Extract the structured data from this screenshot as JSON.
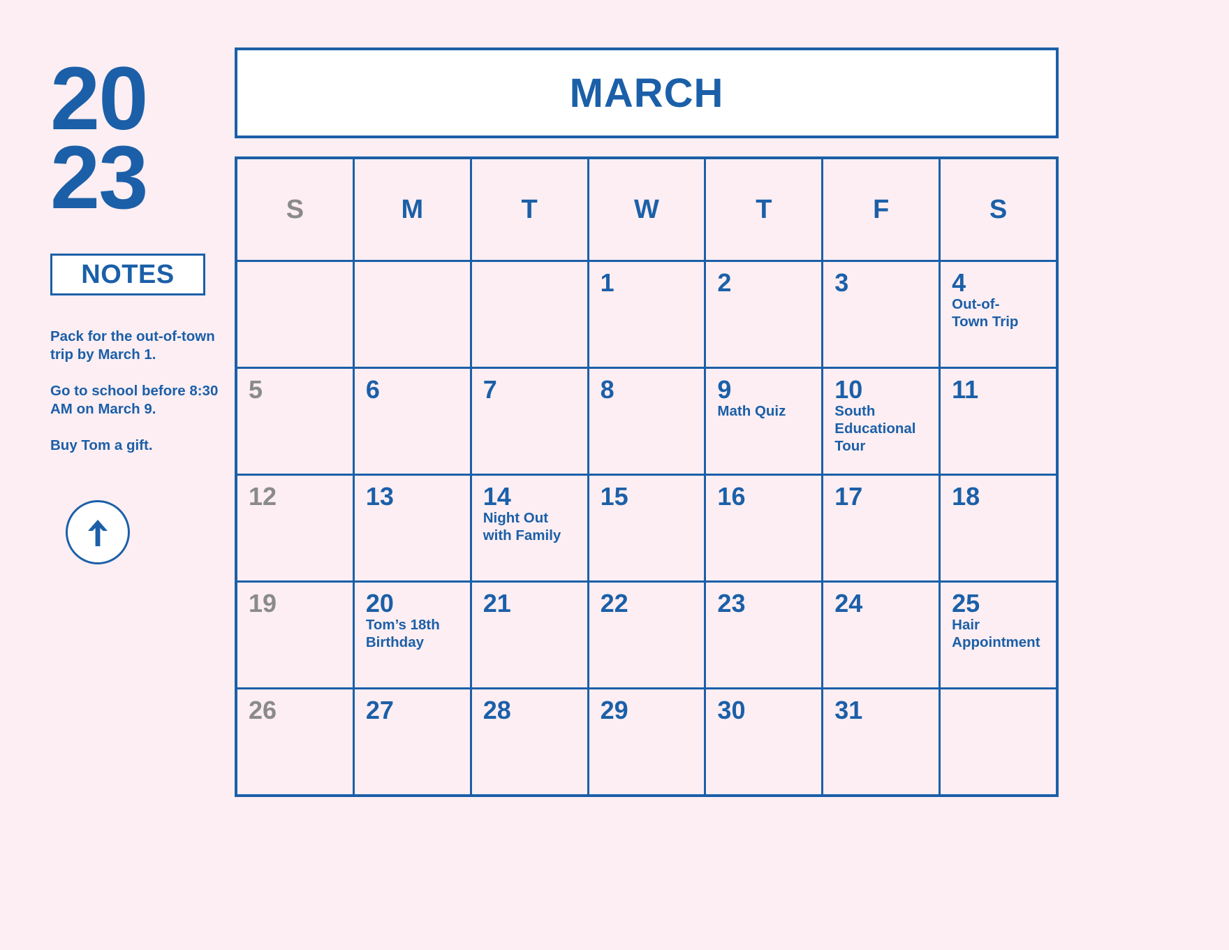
{
  "colors": {
    "page_background": "#fceef2",
    "accent": "#1b5fa8",
    "muted": "#8a8a8a",
    "panel_background": "#ffffff"
  },
  "sidebar": {
    "year_line_1": "20",
    "year_line_2": "23",
    "notes_label": "NOTES",
    "notes": [
      "Pack for the out-of-town trip by March 1.",
      "Go to school before 8:30 AM on March 9.",
      "Buy Tom a gift."
    ],
    "scroll_arrow_icon": "arrow-up-icon"
  },
  "calendar": {
    "month_title": "MARCH",
    "weekday_headers": [
      {
        "label": "S",
        "muted": true
      },
      {
        "label": "M",
        "muted": false
      },
      {
        "label": "T",
        "muted": false
      },
      {
        "label": "W",
        "muted": false
      },
      {
        "label": "T",
        "muted": false
      },
      {
        "label": "F",
        "muted": false
      },
      {
        "label": "S",
        "muted": false
      }
    ],
    "weeks": [
      [
        {
          "day": "",
          "event": "",
          "muted": false,
          "empty": true
        },
        {
          "day": "",
          "event": "",
          "muted": false,
          "empty": true
        },
        {
          "day": "",
          "event": "",
          "muted": false,
          "empty": true
        },
        {
          "day": "1",
          "event": "",
          "muted": false,
          "empty": false
        },
        {
          "day": "2",
          "event": "",
          "muted": false,
          "empty": false
        },
        {
          "day": "3",
          "event": "",
          "muted": false,
          "empty": false
        },
        {
          "day": "4",
          "event": "Out-of-\nTown Trip",
          "muted": false,
          "empty": false
        }
      ],
      [
        {
          "day": "5",
          "event": "",
          "muted": true,
          "empty": false
        },
        {
          "day": "6",
          "event": "",
          "muted": false,
          "empty": false
        },
        {
          "day": "7",
          "event": "",
          "muted": false,
          "empty": false
        },
        {
          "day": "8",
          "event": "",
          "muted": false,
          "empty": false
        },
        {
          "day": "9",
          "event": "Math Quiz",
          "muted": false,
          "empty": false
        },
        {
          "day": "10",
          "event": "South\nEducational\nTour",
          "muted": false,
          "empty": false
        },
        {
          "day": "11",
          "event": "",
          "muted": false,
          "empty": false
        }
      ],
      [
        {
          "day": "12",
          "event": "",
          "muted": true,
          "empty": false
        },
        {
          "day": "13",
          "event": "",
          "muted": false,
          "empty": false
        },
        {
          "day": "14",
          "event": "Night Out\nwith Family",
          "muted": false,
          "empty": false
        },
        {
          "day": "15",
          "event": "",
          "muted": false,
          "empty": false
        },
        {
          "day": "16",
          "event": "",
          "muted": false,
          "empty": false
        },
        {
          "day": "17",
          "event": "",
          "muted": false,
          "empty": false
        },
        {
          "day": "18",
          "event": "",
          "muted": false,
          "empty": false
        }
      ],
      [
        {
          "day": "19",
          "event": "",
          "muted": true,
          "empty": false
        },
        {
          "day": "20",
          "event": "Tom’s 18th\nBirthday",
          "muted": false,
          "empty": false
        },
        {
          "day": "21",
          "event": "",
          "muted": false,
          "empty": false
        },
        {
          "day": "22",
          "event": "",
          "muted": false,
          "empty": false
        },
        {
          "day": "23",
          "event": "",
          "muted": false,
          "empty": false
        },
        {
          "day": "24",
          "event": "",
          "muted": false,
          "empty": false
        },
        {
          "day": "25",
          "event": "Hair\nAppointment",
          "muted": false,
          "empty": false
        }
      ],
      [
        {
          "day": "26",
          "event": "",
          "muted": true,
          "empty": false
        },
        {
          "day": "27",
          "event": "",
          "muted": false,
          "empty": false
        },
        {
          "day": "28",
          "event": "",
          "muted": false,
          "empty": false
        },
        {
          "day": "29",
          "event": "",
          "muted": false,
          "empty": false
        },
        {
          "day": "30",
          "event": "",
          "muted": false,
          "empty": false
        },
        {
          "day": "31",
          "event": "",
          "muted": false,
          "empty": false
        },
        {
          "day": "",
          "event": "",
          "muted": false,
          "empty": true
        }
      ]
    ]
  }
}
